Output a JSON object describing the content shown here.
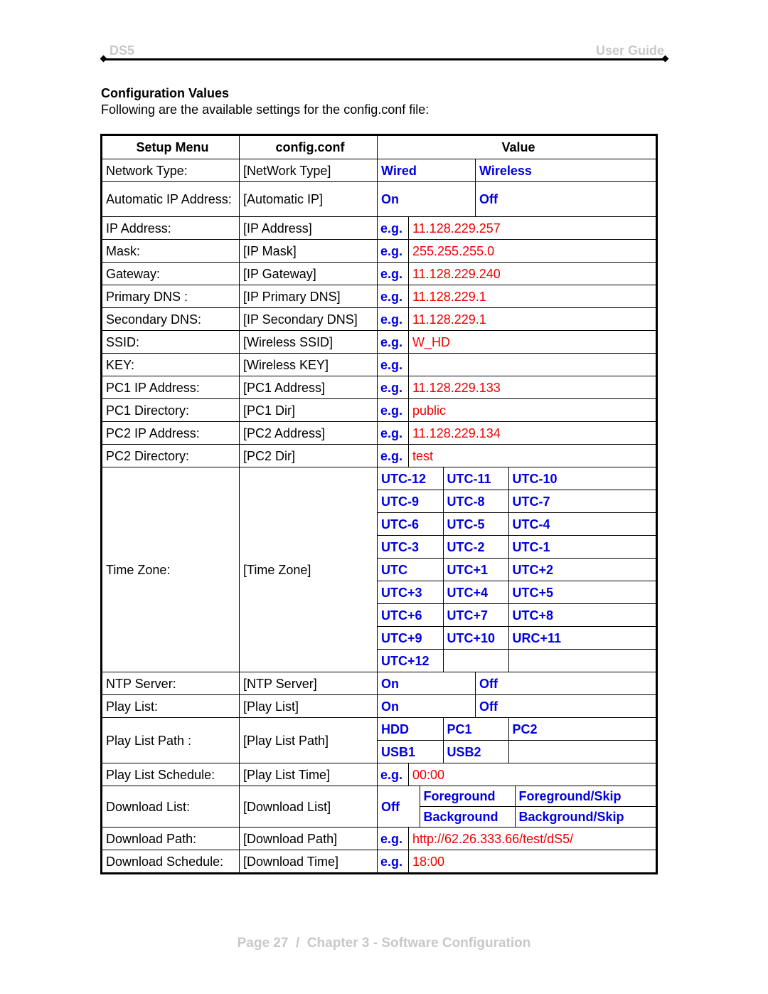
{
  "header": {
    "left": "DS5",
    "right": "User Guide"
  },
  "section": {
    "title": "Configuration Values",
    "intro": "Following are the available settings for the config.conf file:"
  },
  "table": {
    "headers": [
      "Setup Menu",
      "config.conf",
      "Value"
    ],
    "eg_label": "e.g.",
    "rows": {
      "network_type": {
        "menu": "Network Type:",
        "conf": "[NetWork Type]",
        "options": [
          "Wired",
          "Wireless"
        ]
      },
      "automatic_ip": {
        "menu": "Automatic IP Address:",
        "conf": "[Automatic IP]",
        "options": [
          "On",
          "Off"
        ]
      },
      "ip_address": {
        "menu": "IP Address:",
        "conf": "[IP Address]",
        "example": "11.128.229.257"
      },
      "mask": {
        "menu": "Mask:",
        "conf": "[IP Mask]",
        "example": "255.255.255.0"
      },
      "gateway": {
        "menu": "Gateway:",
        "conf": "[IP Gateway]",
        "example": "11.128.229.240"
      },
      "primary_dns": {
        "menu": "Primary DNS :",
        "conf": "[IP Primary DNS]",
        "example": "11.128.229.1"
      },
      "secondary_dns": {
        "menu": "Secondary DNS:",
        "conf": "[IP Secondary DNS]",
        "example": "11.128.229.1"
      },
      "ssid": {
        "menu": "SSID:",
        "conf": "[Wireless SSID]",
        "example": "W_HD"
      },
      "key": {
        "menu": "KEY:",
        "conf": "[Wireless KEY]",
        "example": ""
      },
      "pc1_ip": {
        "menu": "PC1 IP Address:",
        "conf": "[PC1 Address]",
        "example": "11.128.229.133"
      },
      "pc1_dir": {
        "menu": "PC1 Directory:",
        "conf": "[PC1 Dir]",
        "example": "public"
      },
      "pc2_ip": {
        "menu": "PC2 IP Address:",
        "conf": "[PC2 Address]",
        "example": "11.128.229.134"
      },
      "pc2_dir": {
        "menu": "PC2 Directory:",
        "conf": "[PC2 Dir]",
        "example": "test"
      },
      "time_zone": {
        "menu": "Time Zone:",
        "conf": "[Time Zone]",
        "options": [
          [
            "UTC-12",
            "UTC-11",
            "UTC-10"
          ],
          [
            "UTC-9",
            "UTC-8",
            "UTC-7"
          ],
          [
            "UTC-6",
            "UTC-5",
            "UTC-4"
          ],
          [
            "UTC-3",
            "UTC-2",
            "UTC-1"
          ],
          [
            "UTC",
            "UTC+1",
            "UTC+2"
          ],
          [
            "UTC+3",
            "UTC+4",
            "UTC+5"
          ],
          [
            "UTC+6",
            "UTC+7",
            "UTC+8"
          ],
          [
            "UTC+9",
            "UTC+10",
            "URC+11"
          ],
          [
            "UTC+12",
            "",
            ""
          ]
        ]
      },
      "ntp_server": {
        "menu": "NTP Server:",
        "conf": "[NTP Server]",
        "options": [
          "On",
          "Off"
        ]
      },
      "play_list": {
        "menu": "Play List:",
        "conf": "[Play List]",
        "options": [
          "On",
          "Off"
        ]
      },
      "play_list_path": {
        "menu": "Play List Path :",
        "conf": "[Play List Path]",
        "options": [
          [
            "HDD",
            "PC1",
            "PC2"
          ],
          [
            "USB1",
            "USB2",
            ""
          ]
        ]
      },
      "play_list_schedule": {
        "menu": "Play List Schedule:",
        "conf": "[Play List Time]",
        "example": "00:00"
      },
      "download_list": {
        "menu": "Download List:",
        "conf": "[Download List]",
        "off": "Off",
        "options": [
          [
            "Foreground",
            "Foreground/Skip"
          ],
          [
            "Background",
            "Background/Skip"
          ]
        ]
      },
      "download_path": {
        "menu": "Download Path:",
        "conf": "[Download Path]",
        "example": "http://62.26.333.66/test/dS5/"
      },
      "download_schedule": {
        "menu": "Download Schedule:",
        "conf": "[Download Time]",
        "example": "18:00"
      }
    }
  },
  "footer": {
    "text": "Page 27  /  Chapter 3 - Software Configuration"
  },
  "colors": {
    "option_blue": "#0000e0",
    "example_red": "#ee0000",
    "header_gray": "#c8c8c8"
  }
}
